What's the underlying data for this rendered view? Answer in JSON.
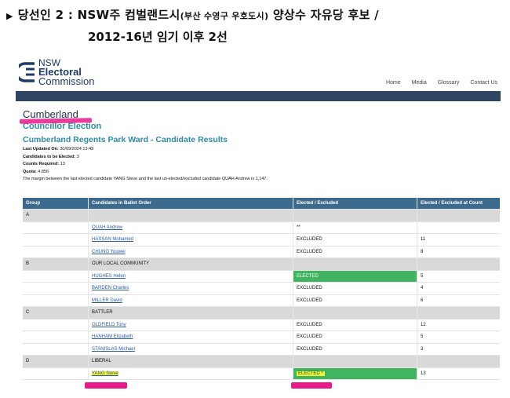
{
  "caption": {
    "line1_main": "당선인 2 : NSW주 컴벌랜드시",
    "line1_small": "(부산 수영구 우호도시)",
    "line1_tail": " 양상수 자유당 후보 /",
    "line2": "2012-16년 임기 이후 2선"
  },
  "site": {
    "logo": {
      "line1": "NSW",
      "line2": "Electoral",
      "line3": "Commission"
    },
    "nav": [
      "Home",
      "Media",
      "Glossary",
      "Contact Us"
    ]
  },
  "page": {
    "title": "Cumberland",
    "subtitle": "Councillor Election",
    "ward_title": "Cumberland Regents Park Ward - Candidate Results",
    "last_updated_label": "Last Updated On:",
    "last_updated_value": "30/09/2024 13:49",
    "candidates_label": "Candidates to be Elected:",
    "candidates_value": "3",
    "counts_label": "Counts Required:",
    "counts_value": "13",
    "quota_label": "Quota:",
    "quota_value": "4,856",
    "margin_note": "The margin between the last elected candidate YANG Steve and the last un-elected/excluded candidate QUAH Andrew is 1,147."
  },
  "table": {
    "headers": [
      "Group",
      "Candidates in Ballot Order",
      "Elected / Excluded",
      "Elected / Excluded at Count"
    ],
    "rows": [
      {
        "type": "group",
        "group": "A",
        "name": ""
      },
      {
        "type": "cand",
        "name": "QUAH Andrew",
        "status": "**",
        "count": "",
        "elected": false
      },
      {
        "type": "cand",
        "name": "HASSAN Mohamed",
        "status": "EXCLUDED",
        "count": "11",
        "elected": false
      },
      {
        "type": "cand",
        "name": "CHUNG Youwei",
        "status": "EXCLUDED",
        "count": "8",
        "elected": false
      },
      {
        "type": "group",
        "group": "B",
        "name": "OUR LOCAL COMMUNITY"
      },
      {
        "type": "cand",
        "name": "HUGHES Helen",
        "status": "ELECTED",
        "count": "5",
        "elected": true
      },
      {
        "type": "cand",
        "name": "BARDEN Charles",
        "status": "EXCLUDED",
        "count": "4",
        "elected": false
      },
      {
        "type": "cand",
        "name": "MILLER David",
        "status": "EXCLUDED",
        "count": "6",
        "elected": false
      },
      {
        "type": "group",
        "group": "C",
        "name": "BATTLER"
      },
      {
        "type": "cand",
        "name": "OLDFIELD Tony",
        "status": "EXCLUDED",
        "count": "12",
        "elected": false
      },
      {
        "type": "cand",
        "name": "HANHAM Elizabeth",
        "status": "EXCLUDED",
        "count": "5",
        "elected": false
      },
      {
        "type": "cand",
        "name": "STANISLAS Michael",
        "status": "EXCLUDED",
        "count": "3",
        "elected": false
      },
      {
        "type": "group",
        "group": "D",
        "name": "LIBERAL"
      },
      {
        "type": "cand",
        "name": "YANG Steve",
        "status": "ELECTED *",
        "count": "13",
        "elected": true
      }
    ]
  },
  "colors": {
    "navbar": "#2f4562",
    "table_header": "#3c6a8c",
    "elected": "#41b461",
    "highlight_pink": "#e8198b",
    "highlight_yellow": "#f2f233"
  }
}
